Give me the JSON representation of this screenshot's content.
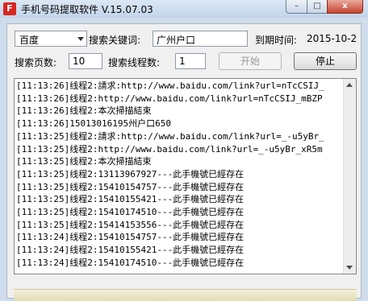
{
  "window": {
    "title": "手机号码提取软件 V.15.07.03",
    "icon_glyph": "F",
    "min_glyph": "–",
    "max_glyph": "□",
    "close_glyph": "x"
  },
  "search": {
    "engine": "百度",
    "keyword_label": "搜索关键词:",
    "keyword_value": "广州户口",
    "expire_label": "到期时间:",
    "expire_value": "2015-10-2",
    "pages_label": "搜索页数:",
    "pages_value": "10",
    "threads_label": "搜索线程数:",
    "threads_value": "1",
    "start_label": "开始",
    "stop_label": "停止"
  },
  "log": {
    "lines": [
      "[11:13:26]线程2:請求:http://www.baidu.com/link?url=nTcCSIJ_",
      "[11:13:26]线程2:http://www.baidu.com/link?url=nTcCSIJ_mBZP",
      "[11:13:26]线程2:本次掃描結束",
      "[11:13:26]15013016195州户口650",
      "[11:13:25]线程2:請求:http://www.baidu.com/link?url=_-u5yBr_",
      "[11:13:25]线程2:http://www.baidu.com/link?url=_-u5yBr_xR5m",
      "[11:13:25]线程2:本次掃描結束",
      "[11:13:25]线程2:13113967927---此手機號已經存在",
      "[11:13:25]线程2:15410154757---此手機號已經存在",
      "[11:13:25]线程2:15410155421---此手機號已經存在",
      "[11:13:25]线程2:15410174510---此手機號已經存在",
      "[11:13:25]线程2:15414153556---此手機號已經存在",
      "[11:13:24]线程2:15410154757---此手機號已經存在",
      "[11:13:24]线程2:15410155421---此手機號已經存在",
      "[11:13:24]线程2:15410174510---此手機號已經存在"
    ]
  }
}
